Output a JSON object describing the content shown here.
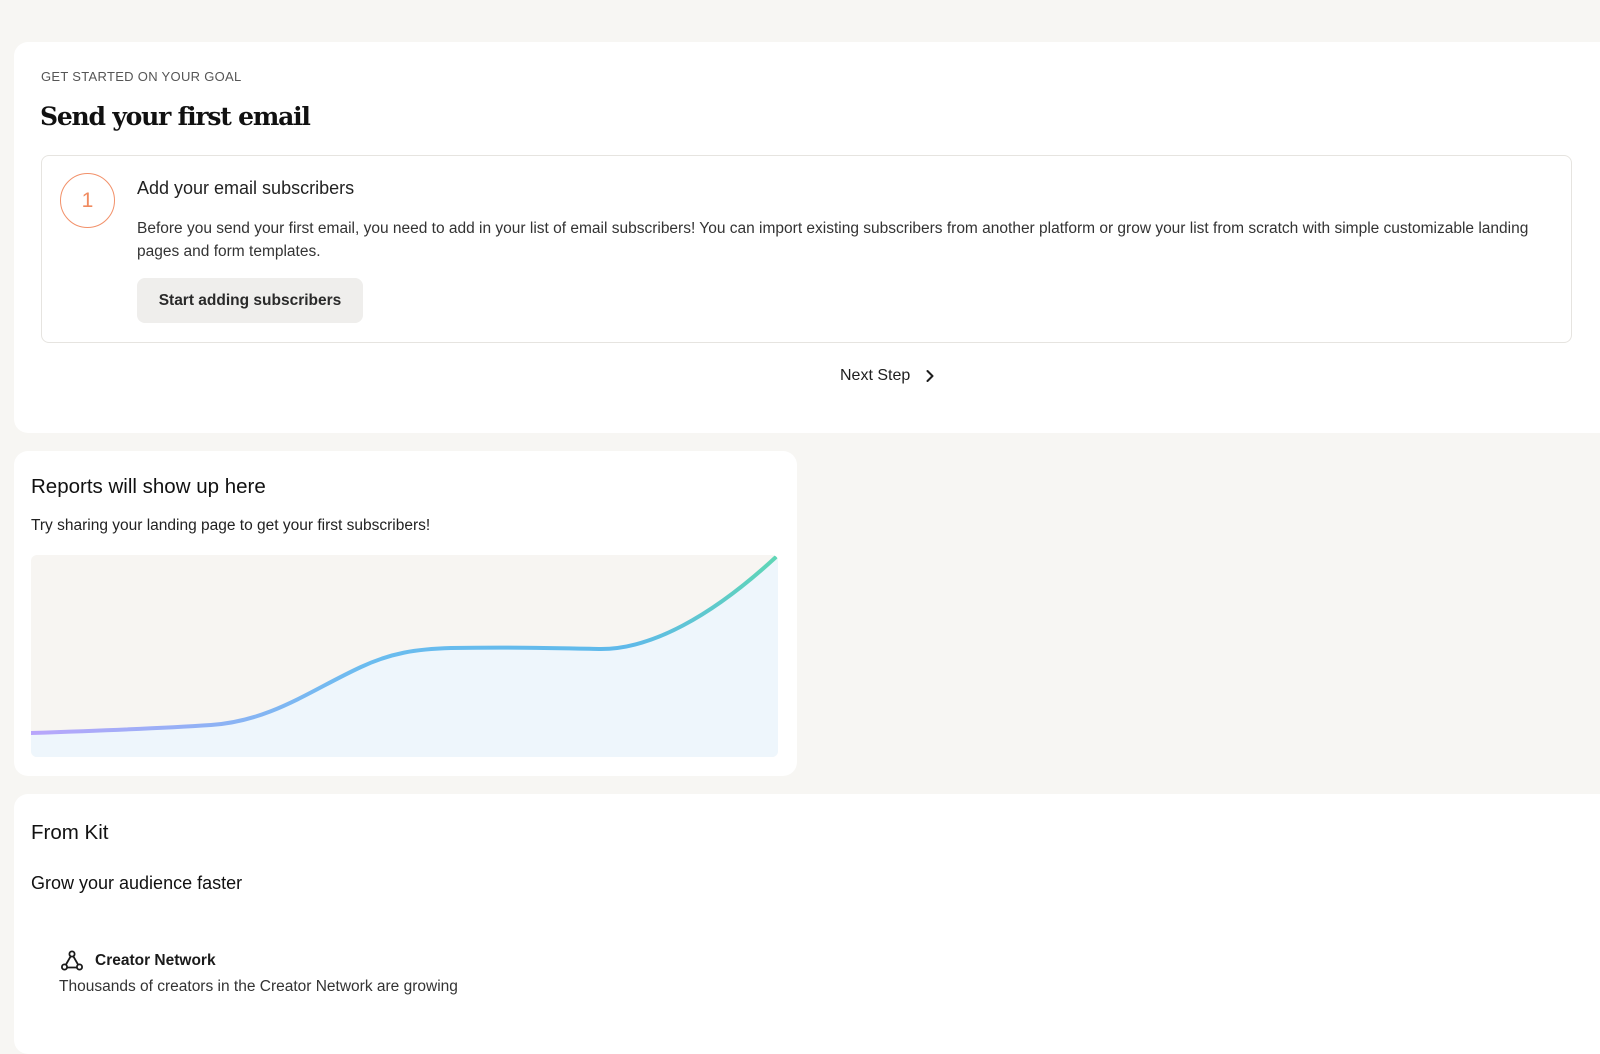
{
  "goal": {
    "eyebrow": "GET STARTED ON YOUR GOAL",
    "title": "Send your first email",
    "step": {
      "number": "1",
      "title": "Add your email subscribers",
      "description": "Before you send your first email, you need to add in your list of email subscribers! You can import existing subscribers from another platform or grow your list from scratch with simple customizable landing pages and form templates.",
      "button_label": "Start adding subscribers",
      "accent_color": "#f08a5f"
    },
    "next_step_label": "Next Step"
  },
  "reports": {
    "title": "Reports will show up here",
    "subtitle": "Try sharing your landing page to get your first subscribers!",
    "chart_gradient": [
      "#b9a6fb",
      "#6bbcef",
      "#5fd6b6"
    ]
  },
  "kit": {
    "title": "From Kit",
    "subtitle": "Grow your audience faster",
    "feature": {
      "icon": "network-icon",
      "label": "Creator Network",
      "description": "Thousands of creators in the Creator Network are growing"
    }
  }
}
